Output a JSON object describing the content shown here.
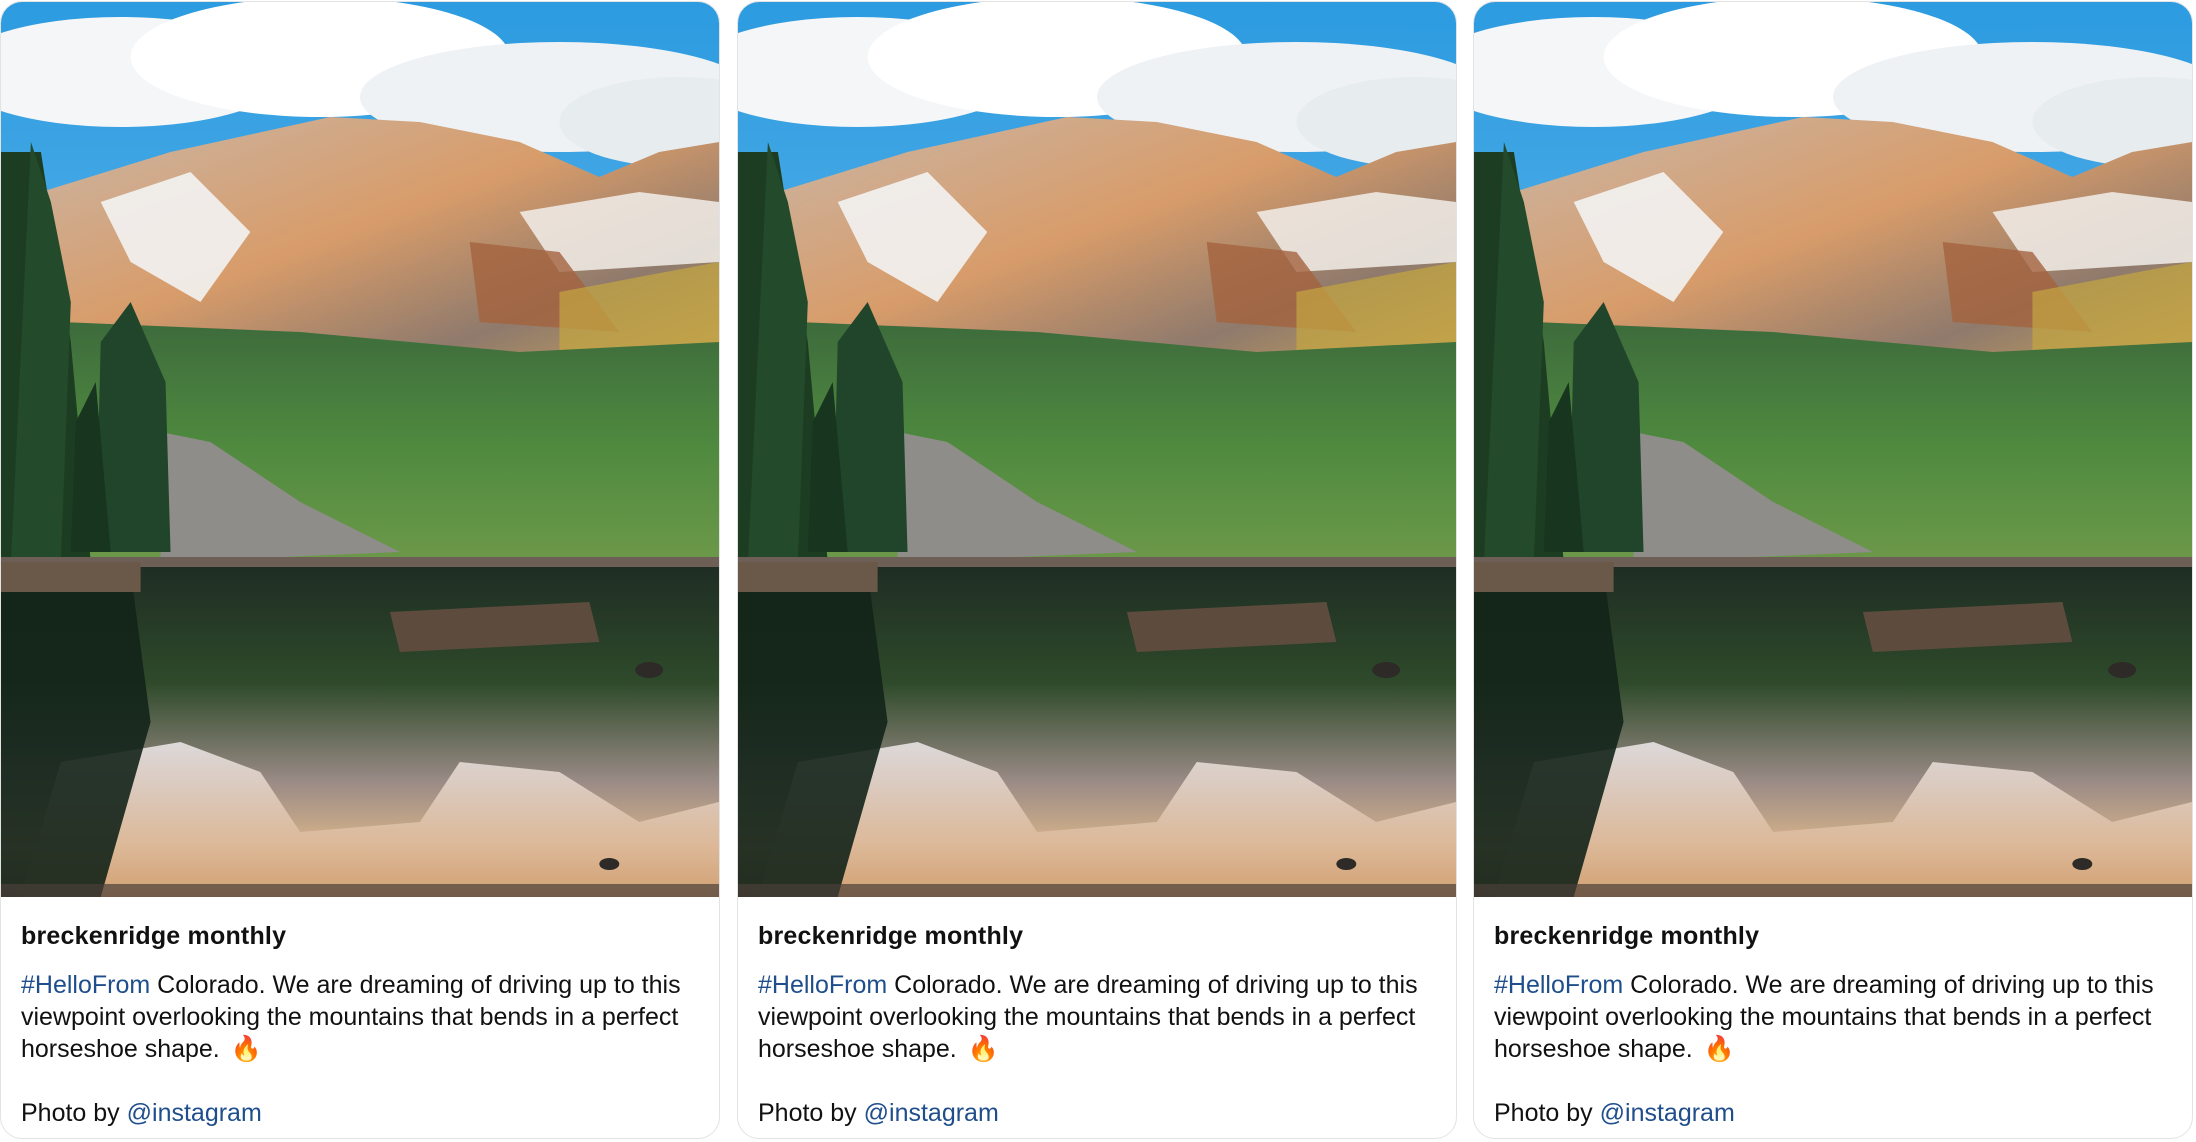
{
  "cards": [
    {
      "author": "breckenridge monthly",
      "hashtag": "#HelloFrom",
      "text": " Colorado. We are dreaming of driving up to this viewpoint overlooking the mountains that bends in a perfect horseshoe shape. ",
      "emoji": "🔥",
      "credit_prefix": "Photo by ",
      "credit_handle": "@instagram"
    },
    {
      "author": "breckenridge monthly",
      "hashtag": "#HelloFrom",
      "text": " Colorado. We are dreaming of driving up to this viewpoint overlooking the mountains that bends in a perfect horseshoe shape. ",
      "emoji": "🔥",
      "credit_prefix": "Photo by ",
      "credit_handle": "@instagram"
    },
    {
      "author": "breckenridge monthly",
      "hashtag": "#HelloFrom",
      "text": " Colorado. We are dreaming of driving up to this viewpoint overlooking the mountains that bends in a perfect horseshoe shape. ",
      "emoji": "🔥",
      "credit_prefix": "Photo by ",
      "credit_handle": "@instagram"
    }
  ],
  "colors": {
    "link": "#1f4e8c",
    "text": "#111111",
    "border": "#e3e3e3"
  }
}
